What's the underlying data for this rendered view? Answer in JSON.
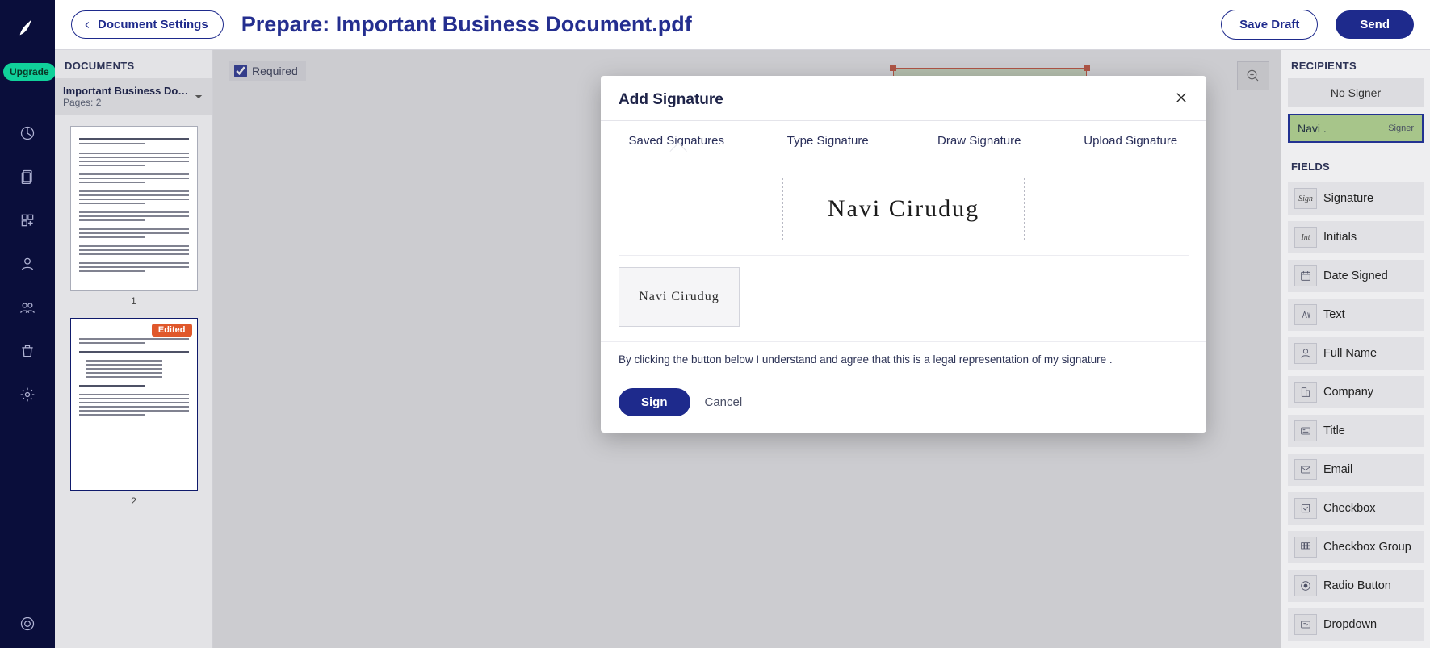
{
  "leftRail": {
    "upgrade": "Upgrade"
  },
  "topBar": {
    "docSettings": "Document Settings",
    "title": "Prepare: Important Business Document.pdf",
    "saveDraft": "Save Draft",
    "send": "Send"
  },
  "docsSidebar": {
    "header": "DOCUMENTS",
    "selectedName": "Important Business Do…",
    "selectedSub": "Pages: 2",
    "pages": [
      "1",
      "2"
    ],
    "editedBadge": "Edited"
  },
  "canvas": {
    "requiredLabel": "Required",
    "requiredChecked": true
  },
  "rightSidebar": {
    "recipientsHeader": "RECIPIENTS",
    "noSigner": "No Signer",
    "signerName": "Navi .",
    "signerRole": "Signer",
    "fieldsHeader": "FIELDS",
    "fields": [
      "Signature",
      "Initials",
      "Date Signed",
      "Text",
      "Full Name",
      "Company",
      "Title",
      "Email",
      "Checkbox",
      "Checkbox Group",
      "Radio Button",
      "Dropdown"
    ]
  },
  "modal": {
    "title": "Add Signature",
    "tabs": [
      "Saved Signatures",
      "Type Signature",
      "Draw Signature",
      "Upload Signature"
    ],
    "activeTab": 0,
    "previewText": "Navi  Cirudug",
    "thumbText": "Navi  Cirudug",
    "legal": "By clicking the button below I understand and agree that this is a legal representation of my signature .",
    "sign": "Sign",
    "cancel": "Cancel"
  }
}
